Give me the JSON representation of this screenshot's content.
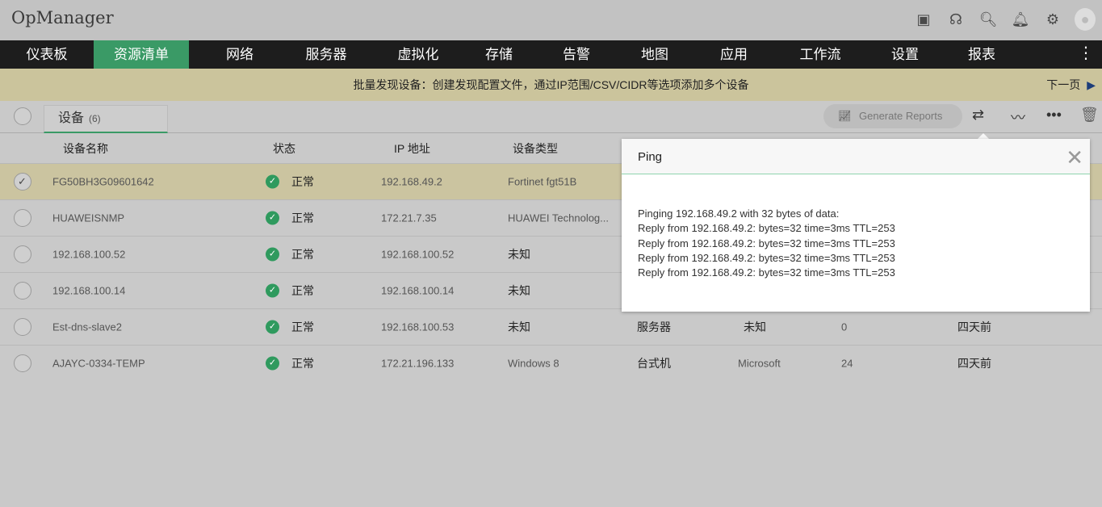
{
  "app": {
    "title": "OpManager"
  },
  "header_icons": [
    "presentation-icon",
    "support-headset-icon",
    "search-icon",
    "bell-icon",
    "gear-icon",
    "avatar-icon"
  ],
  "nav": {
    "items": [
      "仪表板",
      "资源清单",
      "网络",
      "服务器",
      "虚拟化",
      "存储",
      "告警",
      "地图",
      "应用",
      "工作流",
      "设置",
      "报表"
    ],
    "active": "资源清单"
  },
  "banner": {
    "text": "批量发现设备：创建发现配置文件，通过IP范围/CSV/CIDR等选项添加多个设备",
    "next": "下一页"
  },
  "tab": {
    "label": "设备",
    "count": "(6)"
  },
  "toolbar": {
    "generate_reports": "Generate Reports"
  },
  "table": {
    "headers": [
      "设备名称",
      "状态",
      "IP 地址",
      "设备类型"
    ],
    "rows": [
      {
        "name": "FG50BH3G09601642",
        "status": "正常",
        "ip": "192.168.49.2",
        "type": "Fortinet fgt51B",
        "selected": true
      },
      {
        "name": "HUAWEISNMP",
        "status": "正常",
        "ip": "172.21.7.35",
        "type": "HUAWEI Technolog..."
      },
      {
        "name": "192.168.100.52",
        "status": "正常",
        "ip": "192.168.100.52",
        "type": "未知"
      },
      {
        "name": "192.168.100.14",
        "status": "正常",
        "ip": "192.168.100.14",
        "type": "未知"
      },
      {
        "name": "Est-dns-slave2",
        "status": "正常",
        "ip": "192.168.100.53",
        "type": "未知",
        "category": "服务器",
        "vendor": "未知",
        "count": "0",
        "time": "四天前"
      },
      {
        "name": "AJAYC-0334-TEMP",
        "status": "正常",
        "ip": "172.21.196.133",
        "type": "Windows 8",
        "category": "台式机",
        "vendor": "Microsoft",
        "count": "24",
        "time": "四天前"
      }
    ]
  },
  "ping": {
    "title": "Ping",
    "lines": [
      "Pinging 192.168.49.2 with 32 bytes of data:",
      "Reply from 192.168.49.2: bytes=32 time=3ms TTL=253",
      "Reply from 192.168.49.2: bytes=32 time=3ms TTL=253",
      "Reply from 192.168.49.2: bytes=32 time=3ms TTL=253",
      "Reply from 192.168.49.2: bytes=32 time=3ms TTL=253"
    ]
  }
}
